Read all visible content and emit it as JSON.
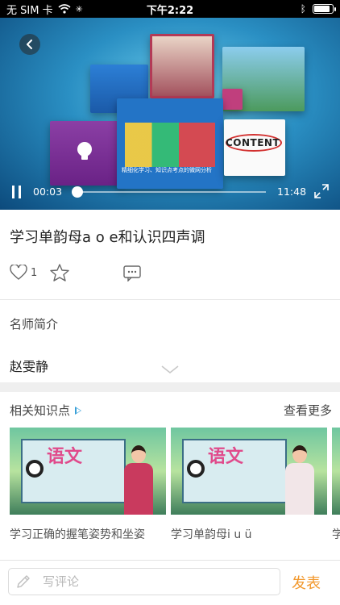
{
  "status_bar": {
    "carrier": "无 SIM 卡",
    "time": "下午2:22",
    "battery_level": 0.9
  },
  "video": {
    "current_time": "00:03",
    "duration": "11:48",
    "progress": 0.004,
    "slide_caption": "精细化学习、知识点考点的微网分析",
    "slide_word": "CONTENT"
  },
  "lesson": {
    "title": "学习单韵母a o e和认识四声调",
    "like_count": "1"
  },
  "teacher": {
    "label": "名师简介",
    "name": "赵雯静"
  },
  "related": {
    "heading": "相关知识点",
    "see_more": "查看更多",
    "items": [
      {
        "caption": "学习正确的握笔姿势和坐姿",
        "logo": "语文",
        "outfit_color": "#c93a5e"
      },
      {
        "caption": "学习单韵母i u ü",
        "logo": "语文",
        "outfit_color": "#f2e6e8"
      },
      {
        "caption": "学",
        "logo": "",
        "outfit_color": "#c93a5e"
      }
    ]
  },
  "comment": {
    "placeholder": "写评论",
    "submit_label": "发表"
  },
  "colors": {
    "accent_orange": "#f2992e",
    "accent_blue": "#3aa0d8"
  },
  "icons": [
    "back-arrow-icon",
    "pause-icon",
    "fullscreen-icon",
    "heart-icon",
    "star-icon",
    "comment-icon",
    "chevron-down-icon",
    "play-triangle-icon",
    "pencil-icon",
    "wifi-icon",
    "bluetooth-icon",
    "battery-icon"
  ]
}
